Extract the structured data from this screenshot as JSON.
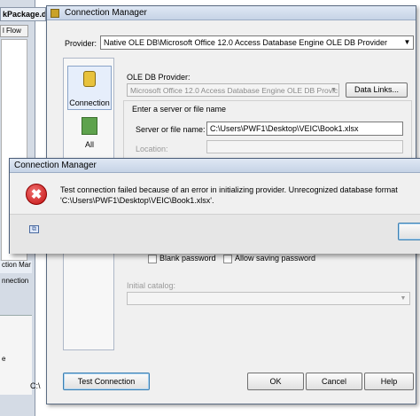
{
  "background": {
    "package_tab": "kPackage.dt",
    "flow_tab": "l Flow",
    "connection_managers_label": "ction Mar",
    "connection_item": "nnection",
    "lower_letter": "e",
    "lower_drive": "C:\\"
  },
  "dialog": {
    "title": "Connection Manager",
    "provider_label": "Provider:",
    "provider_value": "Native OLE DB\\Microsoft Office 12.0 Access Database Engine OLE DB Provider",
    "nav": {
      "connection": "Connection",
      "all": "All"
    },
    "oledb_provider_label": "OLE DB Provider:",
    "oledb_provider_value": "Microsoft Office 12.0 Access Database Engine OLE DB Provic",
    "data_links_button": "Data Links...",
    "server_group_title": "Enter a server or file name",
    "server_label": "Server or file name:",
    "server_value": "C:\\Users\\PWF1\\Desktop\\VEIC\\Book1.xlsx",
    "location_label": "Location:",
    "blank_password": "Blank password",
    "allow_saving_password": "Allow saving password",
    "initial_catalog_label": "Initial catalog:",
    "buttons": {
      "test_connection": "Test Connection",
      "ok": "OK",
      "cancel": "Cancel",
      "help": "Help"
    }
  },
  "error_dialog": {
    "title": "Connection Manager",
    "message_line1": "Test connection failed because of an error in initializing provider. Unrecognized database format",
    "message_line2": "'C:\\Users\\PWF1\\Desktop\\VEIC\\Book1.xlsx'.",
    "icon_glyph": "✖"
  },
  "icons": {
    "error": "error-icon",
    "copy": "copy-icon",
    "connection": "database-icon",
    "all": "properties-icon"
  },
  "colors": {
    "title_bar": "#c6d3e6",
    "dialog_bg": "#f0f0f0",
    "error_red": "#c41010",
    "focus_blue": "#3c7fb1"
  }
}
